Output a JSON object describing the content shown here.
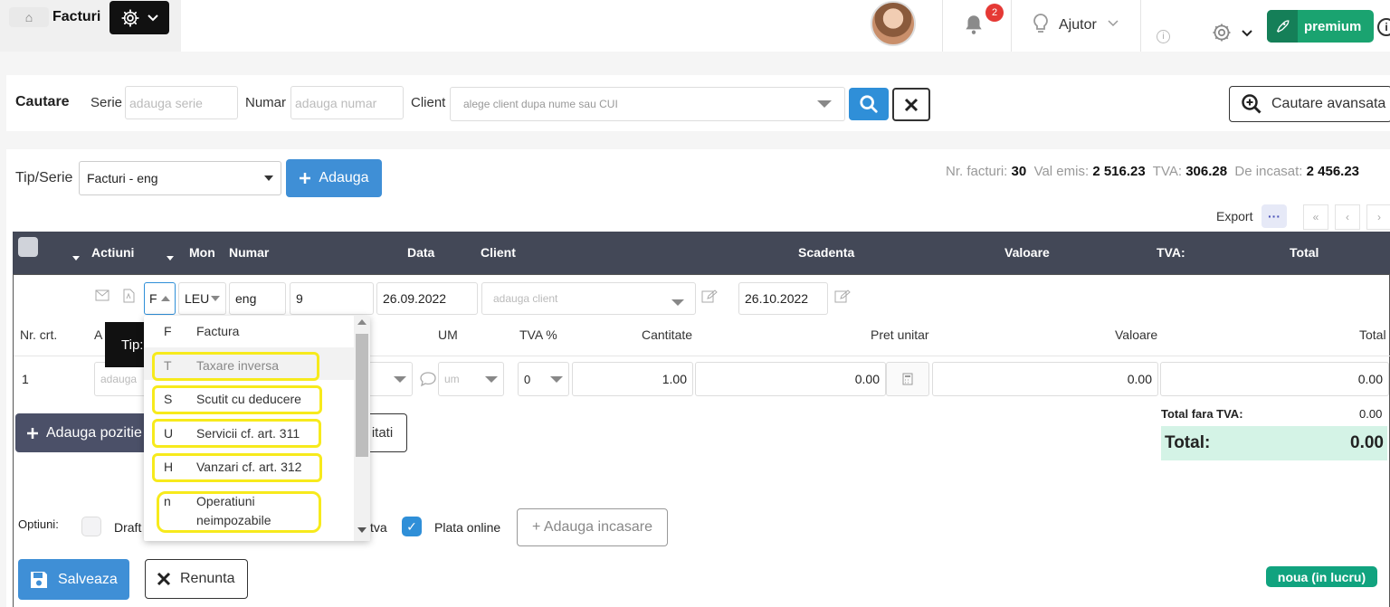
{
  "header": {
    "title": "Facturi",
    "notification_count": "2",
    "help_label": "Ajutor",
    "premium_label": "premium",
    "info_glyph": "i",
    "icons": [
      "home-icon",
      "gear-icon",
      "bell-icon",
      "lightbulb-icon",
      "info-icon",
      "rocket-icon"
    ]
  },
  "search": {
    "title": "Cautare",
    "serie_label": "Serie",
    "serie_placeholder": "adauga serie",
    "numar_label": "Numar",
    "numar_placeholder": "adauga numar",
    "client_label": "Client",
    "client_placeholder": "alege client dupa nume sau CUI",
    "advanced_label": "Cautare avansata"
  },
  "toolbar": {
    "tip_serie_label": "Tip/Serie",
    "tip_serie_value": "Facturi - eng",
    "add_label": "Adauga",
    "stats": {
      "nr_facturi_label": "Nr. facturi:",
      "nr_facturi": "30",
      "val_emis_label": "Val emis:",
      "val_emis": "2 516.23",
      "tva_label": "TVA:",
      "tva": "306.28",
      "de_incasat_label": "De incasat:",
      "de_incasat": "2 456.23"
    },
    "export_label": "Export",
    "pager": [
      "«",
      "‹",
      "›"
    ]
  },
  "table": {
    "headers": [
      "Actiuni",
      "Mon",
      "Numar",
      "Data",
      "Client",
      "Scadenta",
      "Valoare",
      "TVA:",
      "Total"
    ]
  },
  "edit_row": {
    "tip": "F",
    "moneda": "LEU",
    "serie": "eng",
    "numar": "9",
    "data": "26.09.2022",
    "client_placeholder": "adauga client",
    "scadenta": "26.10.2022"
  },
  "positions": {
    "headers": {
      "nr_crt": "Nr. crt.",
      "art_partial": "A",
      "um": "UM",
      "tva": "TVA %",
      "cantitate": "Cantitate",
      "pret_unitar": "Pret unitar",
      "valoare": "Valoare",
      "total": "Total"
    },
    "rows": [
      {
        "nr": "1",
        "articol_placeholder": "adauga",
        "um_placeholder": "um",
        "tva": "0",
        "cantitate": "1.00",
        "pret_unitar": "0.00",
        "valoare": "0.00",
        "total": "0.00"
      }
    ],
    "add_position_label": "Adauga pozitie",
    "cantitati_partial": "itati"
  },
  "totals": {
    "fara_tva_label": "Total fara TVA:",
    "fara_tva": "0.00",
    "total_label": "Total:",
    "total": "0.00"
  },
  "options": {
    "label": "Optiuni:",
    "draft_label": "Draft",
    "tva_partial": "tva",
    "plata_online_label": "Plata online",
    "add_incasare_label": "+ Adauga incasare"
  },
  "actions": {
    "save_label": "Salveaza",
    "cancel_label": "Renunta",
    "status": "noua (in lucru)"
  },
  "tooltip": {
    "text": "Tip:"
  },
  "type_dropdown": {
    "options": [
      {
        "code": "F",
        "name": "Factura"
      },
      {
        "code": "T",
        "name": "Taxare inversa"
      },
      {
        "code": "S",
        "name": "Scutit cu deducere"
      },
      {
        "code": "U",
        "name": "Servicii cf. art. 311"
      },
      {
        "code": "H",
        "name": "Vanzari cf. art. 312"
      },
      {
        "code": "n",
        "name": "Operatiuni",
        "name2": "neimpozabile"
      }
    ]
  },
  "colors": {
    "header_dark": "#434857",
    "primary_blue": "#3f8fd6",
    "premium_green": "#1aa370",
    "status_green": "#11a37f",
    "total_bg": "#d4f3e6",
    "highlight_yellow": "#f7ea1c",
    "badge_red": "#e53935"
  }
}
